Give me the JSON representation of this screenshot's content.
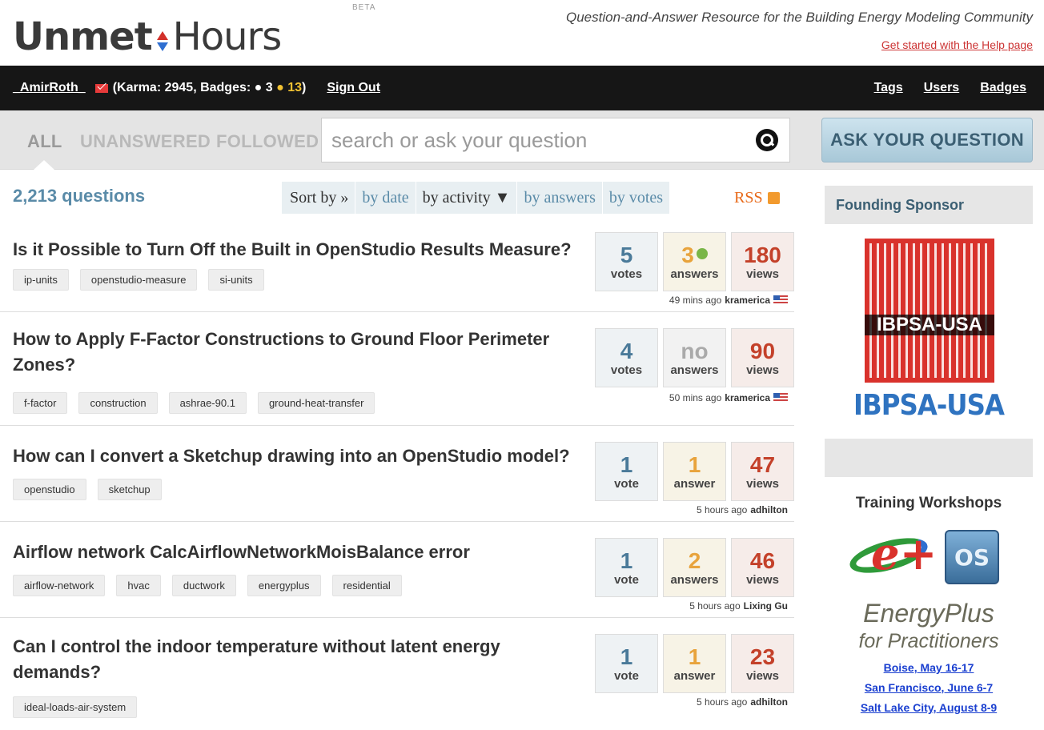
{
  "header": {
    "logo_part1": "Unmet",
    "logo_part2": "Hours",
    "logo_beta": "BETA",
    "tagline": "Question-and-Answer Resource for the Building Energy Modeling Community",
    "help_link": "Get started with the Help page"
  },
  "userbar": {
    "username": "_AmirRoth_",
    "karma_text_1": "(Karma: 2945, Badges: ",
    "badge_silver": "● 3",
    "badge_gold": "● 13",
    "karma_text_2": ")",
    "signout": "Sign Out",
    "links": [
      "Tags",
      "Users",
      "Badges"
    ]
  },
  "nav": {
    "tabs": [
      "ALL",
      "UNANSWERED",
      "FOLLOWED"
    ],
    "active_tab": "ALL",
    "search_placeholder": "search or ask your question",
    "ask_button": "ASK YOUR QUESTION"
  },
  "listing": {
    "count": "2,213 questions",
    "sort_label": "Sort by »",
    "sort_options": [
      "by date",
      "by activity ▼",
      "by answers",
      "by votes"
    ],
    "current_sort": "by activity ▼",
    "rss": "RSS"
  },
  "questions": [
    {
      "title": "Is it Possible to Turn Off the Built in OpenStudio Results Measure?",
      "tags": [
        "ip-units",
        "openstudio-measure",
        "si-units"
      ],
      "votes": "5",
      "votes_label": "votes",
      "answers": "3",
      "answers_label": "answers",
      "accepted": true,
      "views": "180",
      "views_label": "views",
      "time": "49 mins ago",
      "user": "kramerica",
      "flag": true
    },
    {
      "title": "How to Apply F-Factor Constructions to Ground Floor Perimeter Zones?",
      "tags": [
        "f-factor",
        "construction",
        "ashrae-90.1",
        "ground-heat-transfer"
      ],
      "votes": "4",
      "votes_label": "votes",
      "answers": "no",
      "answers_label": "answers",
      "accepted": false,
      "views": "90",
      "views_label": "views",
      "time": "50 mins ago",
      "user": "kramerica",
      "flag": true
    },
    {
      "title": "How can I convert a Sketchup drawing into an OpenStudio model?",
      "tags": [
        "openstudio",
        "sketchup"
      ],
      "votes": "1",
      "votes_label": "vote",
      "answers": "1",
      "answers_label": "answer",
      "accepted": false,
      "views": "47",
      "views_label": "views",
      "time": "5 hours ago",
      "user": "adhilton",
      "flag": false
    },
    {
      "title": "Airflow network CalcAirflowNetworkMoisBalance error",
      "tags": [
        "airflow-network",
        "hvac",
        "ductwork",
        "energyplus",
        "residential"
      ],
      "votes": "1",
      "votes_label": "vote",
      "answers": "2",
      "answers_label": "answers",
      "accepted": false,
      "views": "46",
      "views_label": "views",
      "time": "5 hours ago",
      "user": "Lixing Gu",
      "flag": false
    },
    {
      "title": "Can I control the indoor temperature without latent energy demands?",
      "tags": [
        "ideal-loads-air-system"
      ],
      "votes": "1",
      "votes_label": "vote",
      "answers": "1",
      "answers_label": "answer",
      "accepted": false,
      "views": "23",
      "views_label": "views",
      "time": "5 hours ago",
      "user": "adhilton",
      "flag": false
    }
  ],
  "sidebar": {
    "sponsor_head": "Founding Sponsor",
    "sponsor_logo_text": "IBPSA-USA",
    "sponsor_name": "IBPSA-USA",
    "training_head": "Training Workshops",
    "os_logo_text": "OS",
    "ep_logo_text": "e+",
    "ep_title": "EnergyPlus",
    "ep_sub": "for Practitioners",
    "workshops": [
      "Boise, May 16-17",
      "San Francisco, June 6-7",
      "Salt Lake City, August 8-9"
    ]
  },
  "colors": {
    "accent": "#5a8ba8",
    "brand_red": "#d2302a",
    "brand_blue": "#2f6fd1",
    "views": "#c4412a",
    "answers": "#e8a33c"
  }
}
